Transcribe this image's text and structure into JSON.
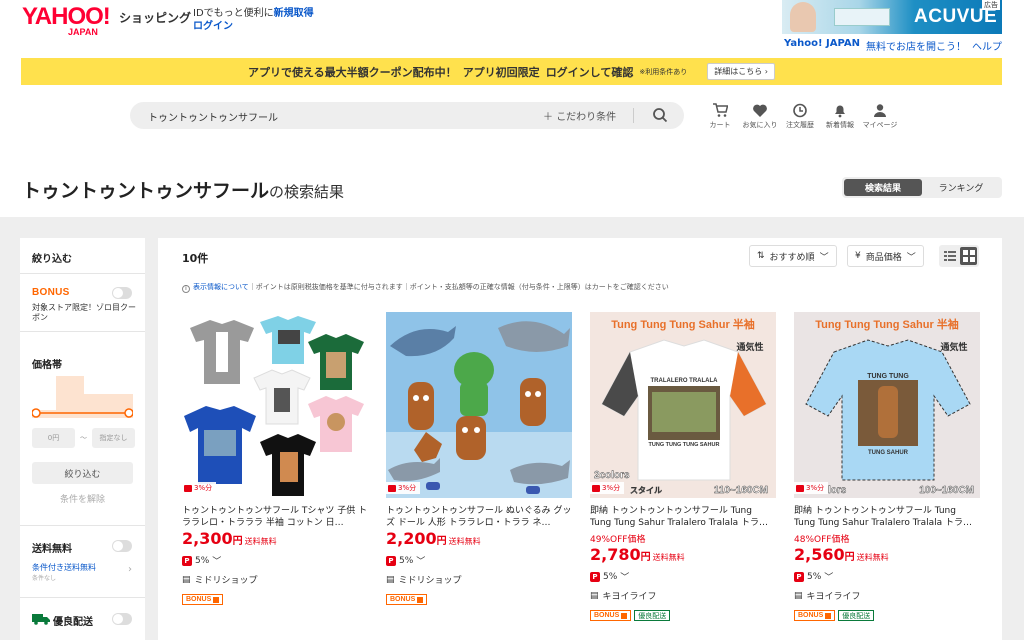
{
  "header": {
    "logo_text": "YAHOO!",
    "logo_sub": "JAPAN",
    "service_name": "ショッピング",
    "login_promo_prefix": "IDでもっと便利に",
    "signup_link": "新規取得",
    "login_link": "ログイン",
    "ad_brand": "ACUVUE",
    "ad_badge": "広告",
    "top_links": {
      "yahoo_japan": "Yahoo! JAPAN",
      "open_store": "無料でお店を開こう！",
      "help": "ヘルプ"
    }
  },
  "banner": {
    "text_1": "アプリで使える最大半額クーポン配布中！",
    "text_2": "アプリ初回限定",
    "text_3": "ログインして確認",
    "note": "※利用条件あり",
    "detail_button": "詳細はこちら"
  },
  "search": {
    "query": "トゥントゥントゥンサフール",
    "filter_label": "こだわり条件"
  },
  "nav": [
    {
      "label": "カート",
      "icon": "cart-icon"
    },
    {
      "label": "お気に入り",
      "icon": "heart-icon"
    },
    {
      "label": "注文履歴",
      "icon": "history-icon"
    },
    {
      "label": "新着情報",
      "icon": "bell-icon"
    },
    {
      "label": "マイページ",
      "icon": "user-icon"
    }
  ],
  "results": {
    "query": "トゥントゥントゥンサフール",
    "title_suffix": "の検索結果",
    "tabs": [
      "検索結果",
      "ランキング"
    ],
    "active_tab": 0
  },
  "sidebar": {
    "narrow_title": "絞り込む",
    "bonus_label": "BONUS",
    "bonus_desc": "対象ストア限定！ゾロ目クーポン",
    "price_title": "価格帯",
    "price_min_placeholder": "0円",
    "price_tilde": "～",
    "price_max_placeholder": "指定なし",
    "narrow_button": "絞り込む",
    "clear_link": "条件を解除",
    "free_shipping_title": "送料無料",
    "conditional_shipping": "条件付き送料無料",
    "conditional_shipping_sub": "条件なし",
    "good_delivery_title": "優良配送"
  },
  "main": {
    "count": "10件",
    "sort_label": "おすすめ順",
    "sort_price": "商品価格",
    "info_link": "表示情報について",
    "info_text": "｜ポイントは原則税抜価格を基準に付与されます｜ポイント・支払額等の正確な情報（付与条件・上限等）はカートをご確認ください"
  },
  "products": [
    {
      "name": "トゥントゥントゥンサフール Tシャツ 子供 トララレロ・トラララ 半袖 コットン 日…",
      "discount": "",
      "price": "2,300",
      "yen": "円",
      "shipping": "送料無料",
      "percent_badge": "3%分",
      "points": "5%",
      "store": "ミドリショップ",
      "tags": [
        "BONUS"
      ]
    },
    {
      "name": "トゥントゥントゥンサフール ぬいぐるみ グッズ ドール 人形 トララレロ・トララ ネ…",
      "discount": "",
      "price": "2,200",
      "yen": "円",
      "shipping": "送料無料",
      "percent_badge": "3%分",
      "points": "5%",
      "store": "ミドリショップ",
      "tags": [
        "BONUS"
      ]
    },
    {
      "name": "即納 トゥントゥントゥンサフール Tung Tung Tung Sahur Tralalero Tralala トラ…",
      "discount": "49%OFF価格",
      "price": "2,780",
      "yen": "円",
      "shipping": "送料無料",
      "percent_badge": "3%分",
      "points": "5%",
      "store": "キヨイライフ",
      "tags": [
        "BONUS",
        "優良配送"
      ],
      "image_text_top": "Tung Tung Tung Sahur 半袖",
      "image_text_side": "通気性",
      "image_text_colors": "2colors",
      "image_text_style": "スタイル",
      "image_text_size": "110~160CM",
      "image_text_print1": "TRALALERO TRALALA",
      "image_text_print2": "TUNG TUNG TUNG SAHUR"
    },
    {
      "name": "即納 トゥントゥントゥンサフール Tung Tung Tung Sahur Tralalero Tralala トラ…",
      "discount": "48%OFF価格",
      "price": "2,560",
      "yen": "円",
      "shipping": "送料無料",
      "percent_badge": "3%分",
      "points": "5%",
      "store": "キヨイライフ",
      "tags": [
        "BONUS",
        "優良配送"
      ],
      "image_text_top": "Tung Tung Tung Sahur 半袖",
      "image_text_side": "通気性",
      "image_text_colors": "lors",
      "image_text_size": "100~160CM",
      "image_text_print1": "TUNG TUNG",
      "image_text_print2": "TUNG SAHUR"
    }
  ],
  "colors": {
    "brand_red": "#ff0033",
    "price_red": "#e60012",
    "banner_yellow": "#ffe14d",
    "link_blue": "#0a58ca",
    "bonus_orange": "#ff6600"
  }
}
